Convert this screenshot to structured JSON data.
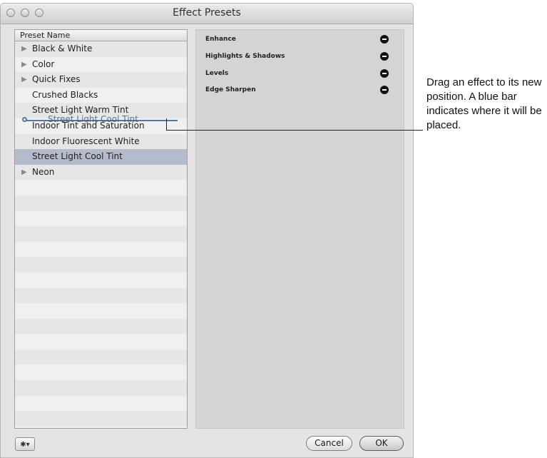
{
  "window": {
    "title": "Effect Presets"
  },
  "list": {
    "header": "Preset Name",
    "rows": [
      {
        "label": "Black & White",
        "disclosure": true
      },
      {
        "label": "Color",
        "disclosure": true
      },
      {
        "label": "Quick Fixes",
        "disclosure": true
      },
      {
        "label": "Crushed Blacks",
        "disclosure": false
      },
      {
        "label": "Street Light Warm Tint",
        "disclosure": false
      },
      {
        "label": "Indoor Tint and Saturation",
        "disclosure": false
      },
      {
        "label": "Indoor Fluorescent White",
        "disclosure": false
      },
      {
        "label": "Street Light Cool Tint",
        "disclosure": false,
        "selected": true
      },
      {
        "label": "Neon",
        "disclosure": true
      }
    ],
    "drag_ghost_label": "Street Light Cool Tint"
  },
  "effects": {
    "items": [
      "Enhance",
      "Highlights & Shadows",
      "Levels",
      "Edge Sharpen"
    ],
    "remove_icon": "minus-circle-icon"
  },
  "footer": {
    "gear_icon": "gear-icon",
    "gear_menu_glyph": "✱▾",
    "cancel_label": "Cancel",
    "ok_label": "OK"
  },
  "callout": {
    "text": "Drag an effect to its new position. A blue bar indicates where it will be placed."
  },
  "colors": {
    "selection": "#b4bccc",
    "drop_indicator": "#5276aa"
  }
}
